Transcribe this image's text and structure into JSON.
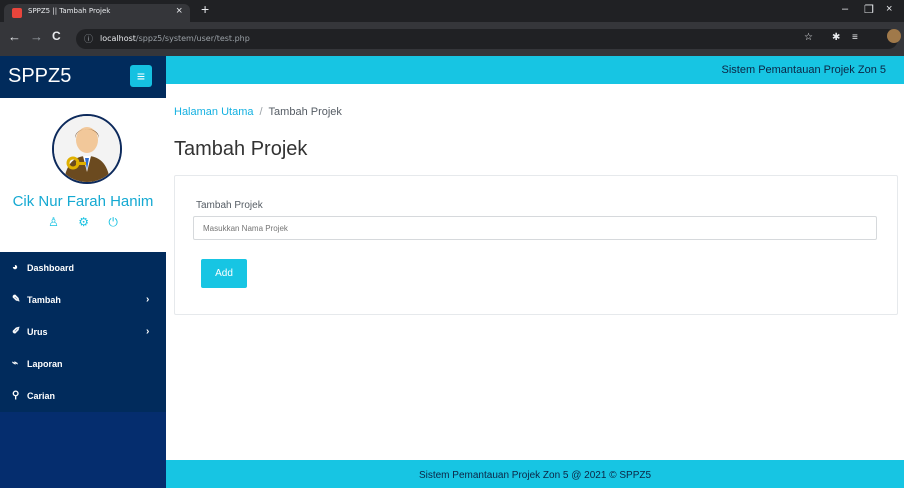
{
  "browser": {
    "tab_title": "SPPZ5 || Tambah Projek",
    "tab_close": "×",
    "new_tab": "+",
    "url_host": "localhost",
    "url_path": "/sppz5/system/user/test.php",
    "nav": {
      "back": "←",
      "forward": "→",
      "reload": "C",
      "info": "ⓘ"
    },
    "controls": {
      "minimize": "–",
      "maximize": "❐",
      "close": "×"
    },
    "toolbar": {
      "star": "☆",
      "extensions": "✱",
      "reading": "≡"
    }
  },
  "sidebar": {
    "brand": "SPPZ5",
    "menu_button": "≡",
    "user_name": "Cik Nur Farah Hanim",
    "user_icons": {
      "profile": "♙",
      "settings": "⚙",
      "logout": "⏻"
    },
    "items": [
      {
        "label": "Dashboard",
        "icon": "◕",
        "caret": ""
      },
      {
        "label": "Tambah",
        "icon": "✎",
        "caret": "›"
      },
      {
        "label": "Urus",
        "icon": "✐",
        "caret": "›"
      },
      {
        "label": "Laporan",
        "icon": "⌁",
        "caret": ""
      },
      {
        "label": "Carian",
        "icon": "⚲",
        "caret": ""
      }
    ]
  },
  "header": {
    "title": "Sistem Pemantauan Projek Zon 5"
  },
  "breadcrumb": {
    "home": "Halaman Utama",
    "separator": "/",
    "current": "Tambah Projek"
  },
  "main": {
    "page_title": "Tambah Projek",
    "form": {
      "label": "Tambah Projek",
      "placeholder": "Masukkan Nama Projek",
      "value": "",
      "button": "Add"
    }
  },
  "footer": {
    "text": "Sistem Pemantauan Projek Zon 5 @ 2021 © SPPZ5"
  },
  "colors": {
    "accent": "#17c5e3",
    "sidebar_bg": "#052d6e",
    "sidebar_item_bg": "#012b5c",
    "user_name": "#15a9d2"
  }
}
